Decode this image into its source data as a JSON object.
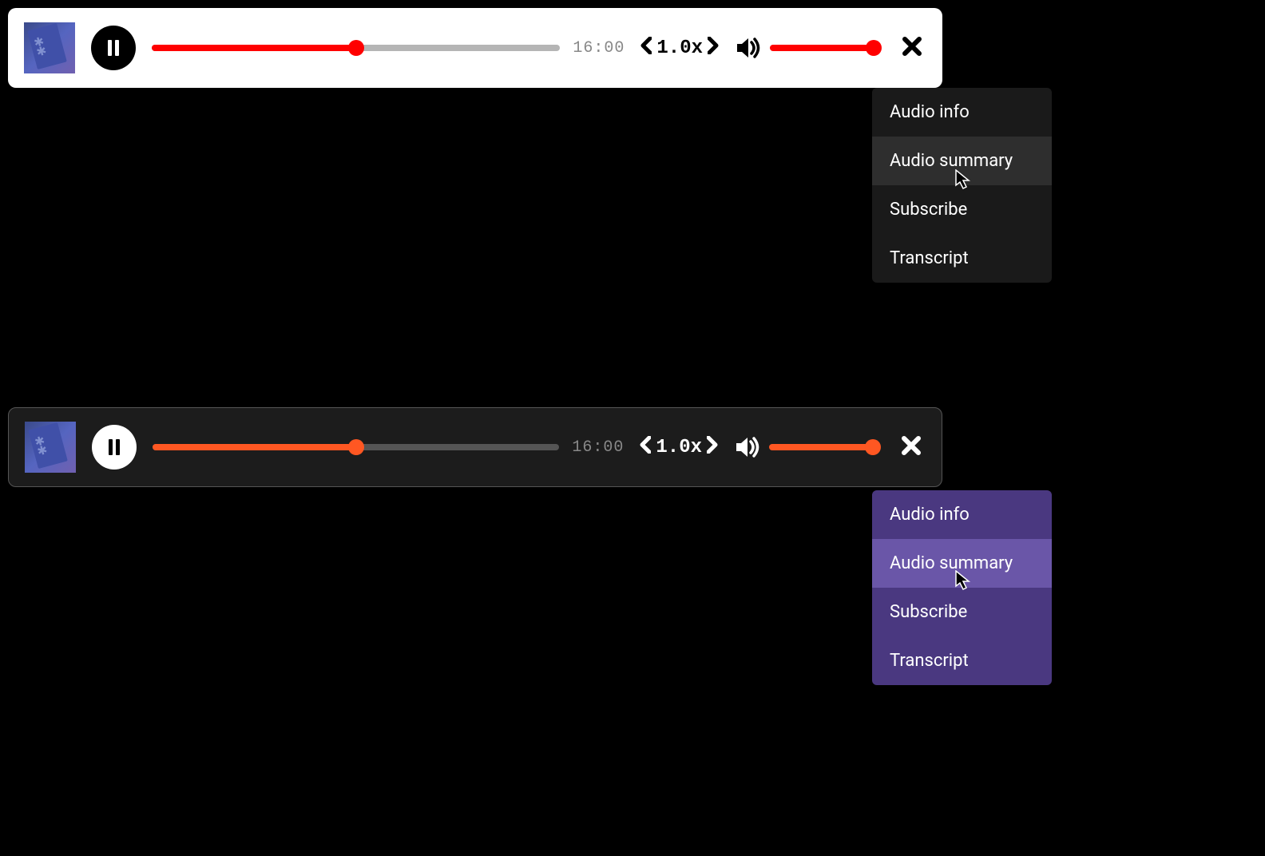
{
  "players": [
    {
      "theme": "light",
      "duration": "16:00",
      "speed": "1.0x",
      "progress_pct": 50,
      "volume_pct": 100
    },
    {
      "theme": "dark",
      "duration": "16:00",
      "speed": "1.0x",
      "progress_pct": 50,
      "volume_pct": 100
    }
  ],
  "menus": [
    {
      "items": [
        {
          "label": "Audio info",
          "hovered": false
        },
        {
          "label": "Audio summary",
          "hovered": true
        },
        {
          "label": "Subscribe",
          "hovered": false
        },
        {
          "label": "Transcript",
          "hovered": false
        }
      ]
    },
    {
      "items": [
        {
          "label": "Audio info",
          "hovered": false
        },
        {
          "label": "Audio summary",
          "hovered": true
        },
        {
          "label": "Subscribe",
          "hovered": false
        },
        {
          "label": "Transcript",
          "hovered": false
        }
      ]
    }
  ],
  "colors": {
    "accent_light": "#ff0000",
    "accent_dark": "#ff5722",
    "menu_dark_bg": "#1a1a1a",
    "menu_dark_hover": "#2e2e2e",
    "menu_purple_bg": "#4a3880",
    "menu_purple_hover": "#6a56a8"
  }
}
